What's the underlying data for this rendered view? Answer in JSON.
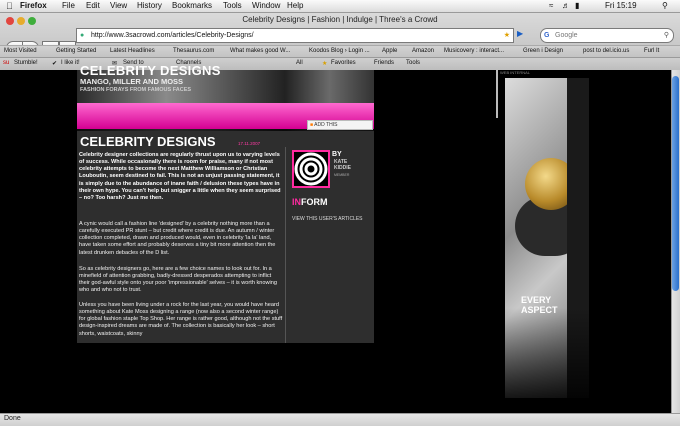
{
  "menubar": {
    "app_name": "Firefox",
    "items": [
      "File",
      "Edit",
      "View",
      "History",
      "Bookmarks",
      "Tools",
      "Window",
      "Help"
    ],
    "clock": "Fri 15:19"
  },
  "window": {
    "title": "Celebrity Designs | Fashion | Indulge | Three's a Crowd"
  },
  "toolbar": {
    "url": "http://www.3sacrowd.com/articles/Celebrity-Designs/",
    "search_placeholder": "Google"
  },
  "bookmarks_bar": [
    "Most Visited",
    "Getting Started",
    "Latest Headlines",
    "Thesaurus.com",
    "What makes good W...",
    "Koodos Blog › Login ...",
    "Apple",
    "Amazon",
    "Musicovery : interact...",
    "Green i Design",
    "post to del.icio.us",
    "Furl It"
  ],
  "stumble_bar": [
    "Stumble!",
    "I like it!",
    "Send to",
    "Channels",
    "All",
    "Favorites",
    "Friends",
    "Tools"
  ],
  "hero": {
    "title": "CELEBRITY DESIGNS",
    "subtitle": "MANGO, MILLER AND MOSS",
    "tagline": "FASHION FORAYS FROM FAMOUS FACES"
  },
  "addthis_label": "ADD THIS",
  "article": {
    "title": "CELEBRITY DESIGNS",
    "date": "17.11.2007",
    "paragraphs": [
      "Celebrity designer collections are regularly thrust upon us to varying levels of success. While occasionally there is room for praise, many if not most celebrity attempts to become the next Matthew Williamson or Christian Louboutin, seem destined to fail. This is not an unjust passing statement, it is simply due to the abundance of inane faith / delusion these types have in their own hype. You can't help but snigger a little when they seem surprised – no? Too harsh? Just me then.",
      "A cynic would call a fashion line 'designed' by a celebrity nothing more than a carefully executed PR stunt – but credit where credit is due. An autumn / winter collection completed, drawn and produced would, even in celebrity 'la la' land, have taken some effort and probably deserves a tiny bit more attention then the latest drunken debacles of the D list.",
      "So as celebrity designers go, here are a few choice names to look out for. In a minefield of attention grabbing, badly-dressed desperados attempting to inflict their god-awful style onto your poor 'impressionable' selves – it is worth knowing who and who not to trust.",
      "Unless you have been living under a rock for the last year, you would have heard something about Kate Moss designing a range (now also a second winter range) for global fashion staple Top Shop. Her range is rather good, although not the stuff design-inspired dreams are made of. The collection is basically her look – short shorts, waistcoats, skinny"
    ]
  },
  "author": {
    "by": "BY",
    "name": "KATE KIDDIE",
    "role": "MEMBER",
    "inform_prefix": "IN",
    "inform_suffix": "FORM",
    "view_link": "VIEW THIS USER'S ARTICLES"
  },
  "ad": {
    "top_label": "WEB INTERNAL",
    "text_line1": "EVERY",
    "text_line2": "ASPECT"
  },
  "status_bar": {
    "text": "Done"
  },
  "colors": {
    "accent_pink": "#ff2aa0",
    "page_bg": "#000000",
    "article_bg": "#2e2e2e"
  }
}
